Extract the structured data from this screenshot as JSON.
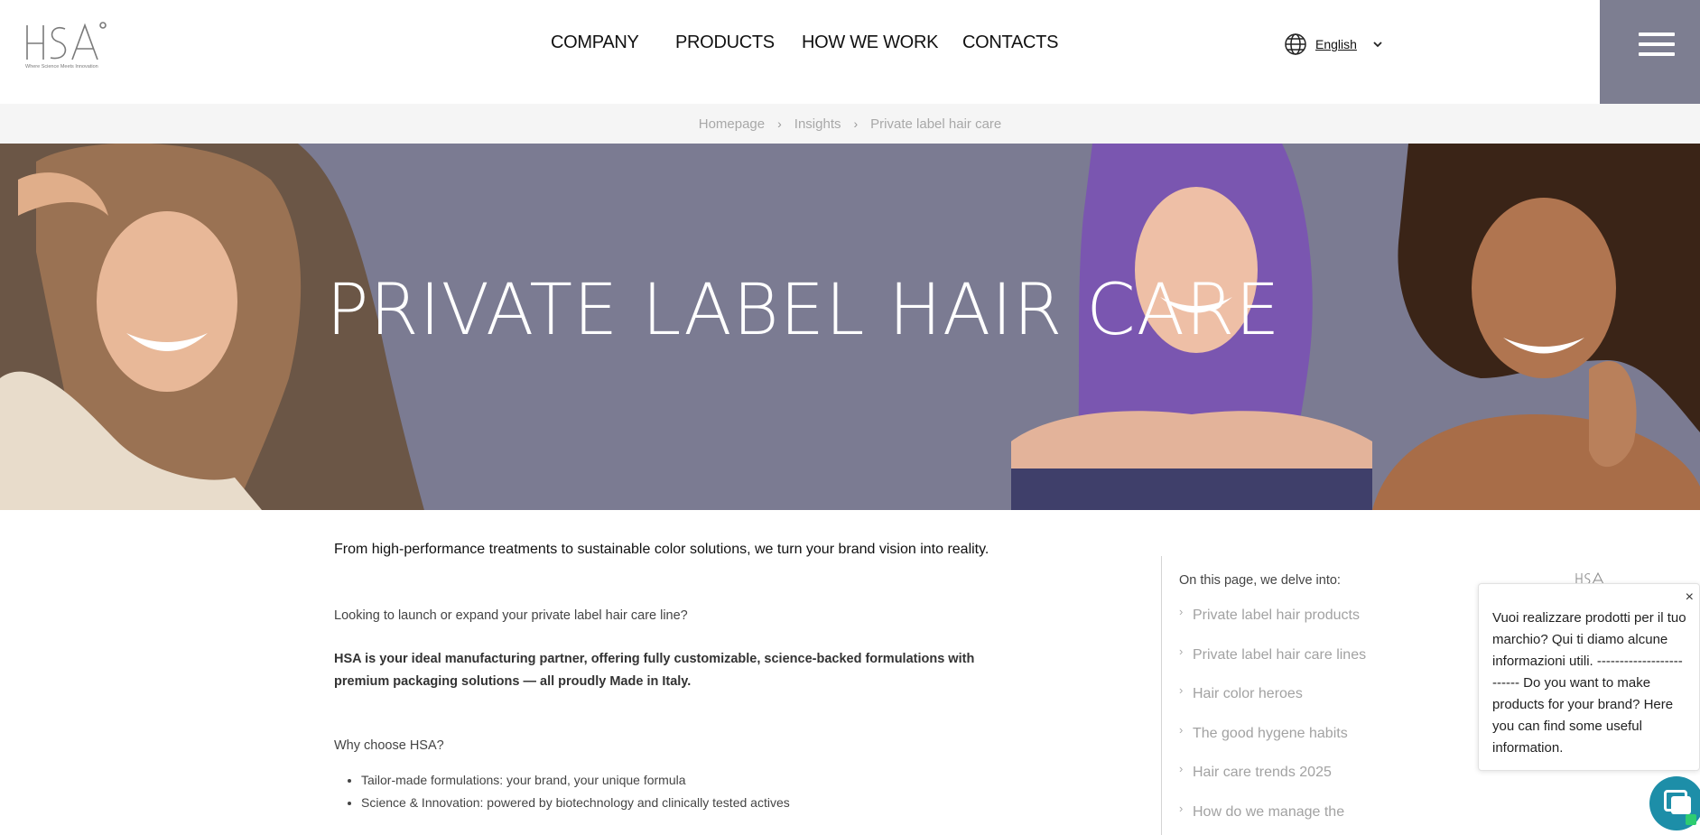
{
  "brand": {
    "logo_text": "HSA",
    "tagline": "Where Science Meets Innovation"
  },
  "nav": {
    "items": [
      {
        "label": "COMPANY"
      },
      {
        "label": "PRODUCTS"
      },
      {
        "label": "HOW WE WORK"
      },
      {
        "label": "CONTACTS"
      }
    ],
    "language": {
      "label": "English",
      "icon": "globe-icon"
    },
    "menu_icon": "hamburger-icon"
  },
  "breadcrumb": {
    "items": [
      "Homepage",
      "Insights",
      "Private label hair care"
    ],
    "separator": "›"
  },
  "hero": {
    "title": "PRIVATE LABEL HAIR CARE",
    "bg_color": "#7b7b92"
  },
  "article": {
    "intro": "From high-performance treatments to sustainable color solutions, we turn your brand vision into reality.",
    "question": "Looking to launch or expand your private label hair care line?",
    "lead": "HSA is your ideal manufacturing partner, offering fully customizable, science-backed formulations with premium packaging solutions — all proudly Made in Italy.",
    "why_heading": "Why choose HSA?",
    "bullets": [
      "Tailor-made formulations: your brand, your unique formula",
      "Science & Innovation: powered by biotechnology and clinically tested actives"
    ]
  },
  "toc": {
    "title": "On this page, we delve into:",
    "items": [
      "Private label hair products",
      "Private label hair care lines",
      "Hair color heroes",
      "The good hygene habits",
      "Hair care trends 2025",
      "How do we manage the"
    ]
  },
  "chat": {
    "mark": "HSA",
    "message": "Vuoi realizzare prodotti per il tuo marchio? Qui ti diamo alcune informazioni utili. ------------------------- Do you want to make products for your brand? Here you can find some useful information.",
    "close_label": "×",
    "accent": "#1d8ea8"
  },
  "colors": {
    "menu_bg": "#7d7e91",
    "breadcrumb_bg": "#f5f5f5"
  }
}
